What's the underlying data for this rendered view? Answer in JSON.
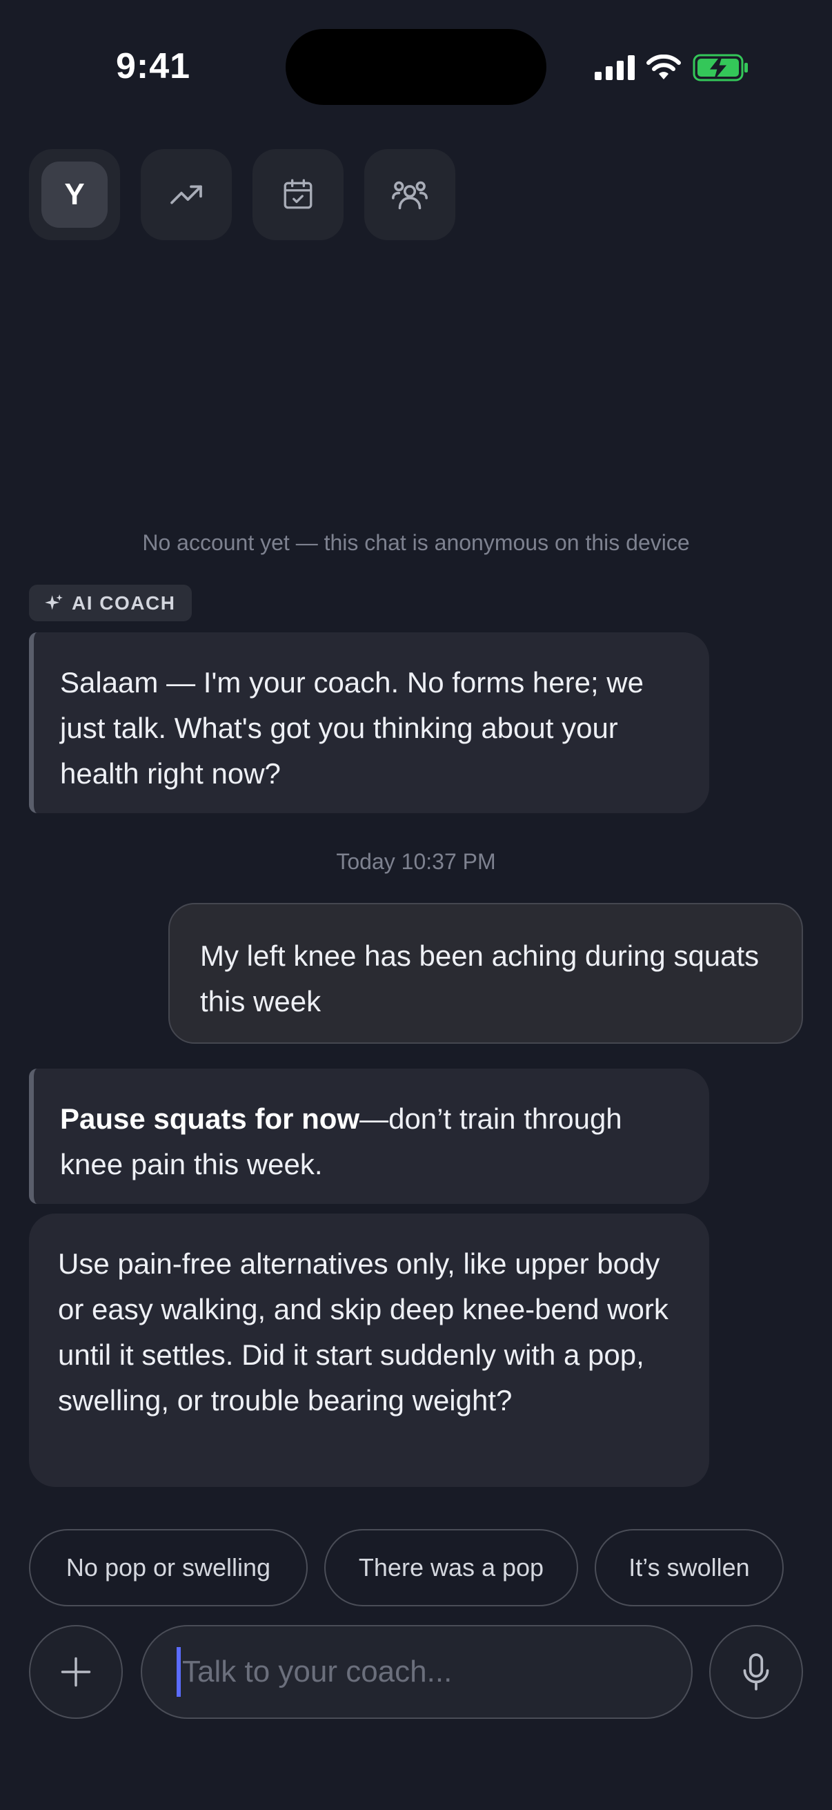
{
  "status_bar": {
    "time": "9:41"
  },
  "nav": {
    "avatar_initial": "Y",
    "items": [
      "trending-up-icon",
      "calendar-check-icon",
      "users-icon"
    ]
  },
  "notice": "No account yet — this chat is anonymous on this device",
  "coach_badge": "AI COACH",
  "messages": {
    "coach_greeting": "Salaam — I'm your coach. No forms here; we just talk. What's got you thinking about your health right now?",
    "timestamp": "Today 10:37 PM",
    "user_message": "My left knee has been aching during squats this week",
    "coach_reply_bold": "Pause squats for now",
    "coach_reply_rest": "—don’t train through knee pain this week.",
    "coach_followup": "Use pain-free alternatives only, like upper body or easy walking, and skip deep knee-bend work until it settles. Did it start suddenly with a pop, swelling, or trouble bearing weight?"
  },
  "quick_replies": [
    "No pop or swelling",
    "There was a pop",
    "It’s swollen"
  ],
  "composer": {
    "placeholder": "Talk to your coach..."
  },
  "colors": {
    "background": "#181b26",
    "bubble": "#262833",
    "caret": "#5b6cff",
    "battery": "#34c759"
  }
}
